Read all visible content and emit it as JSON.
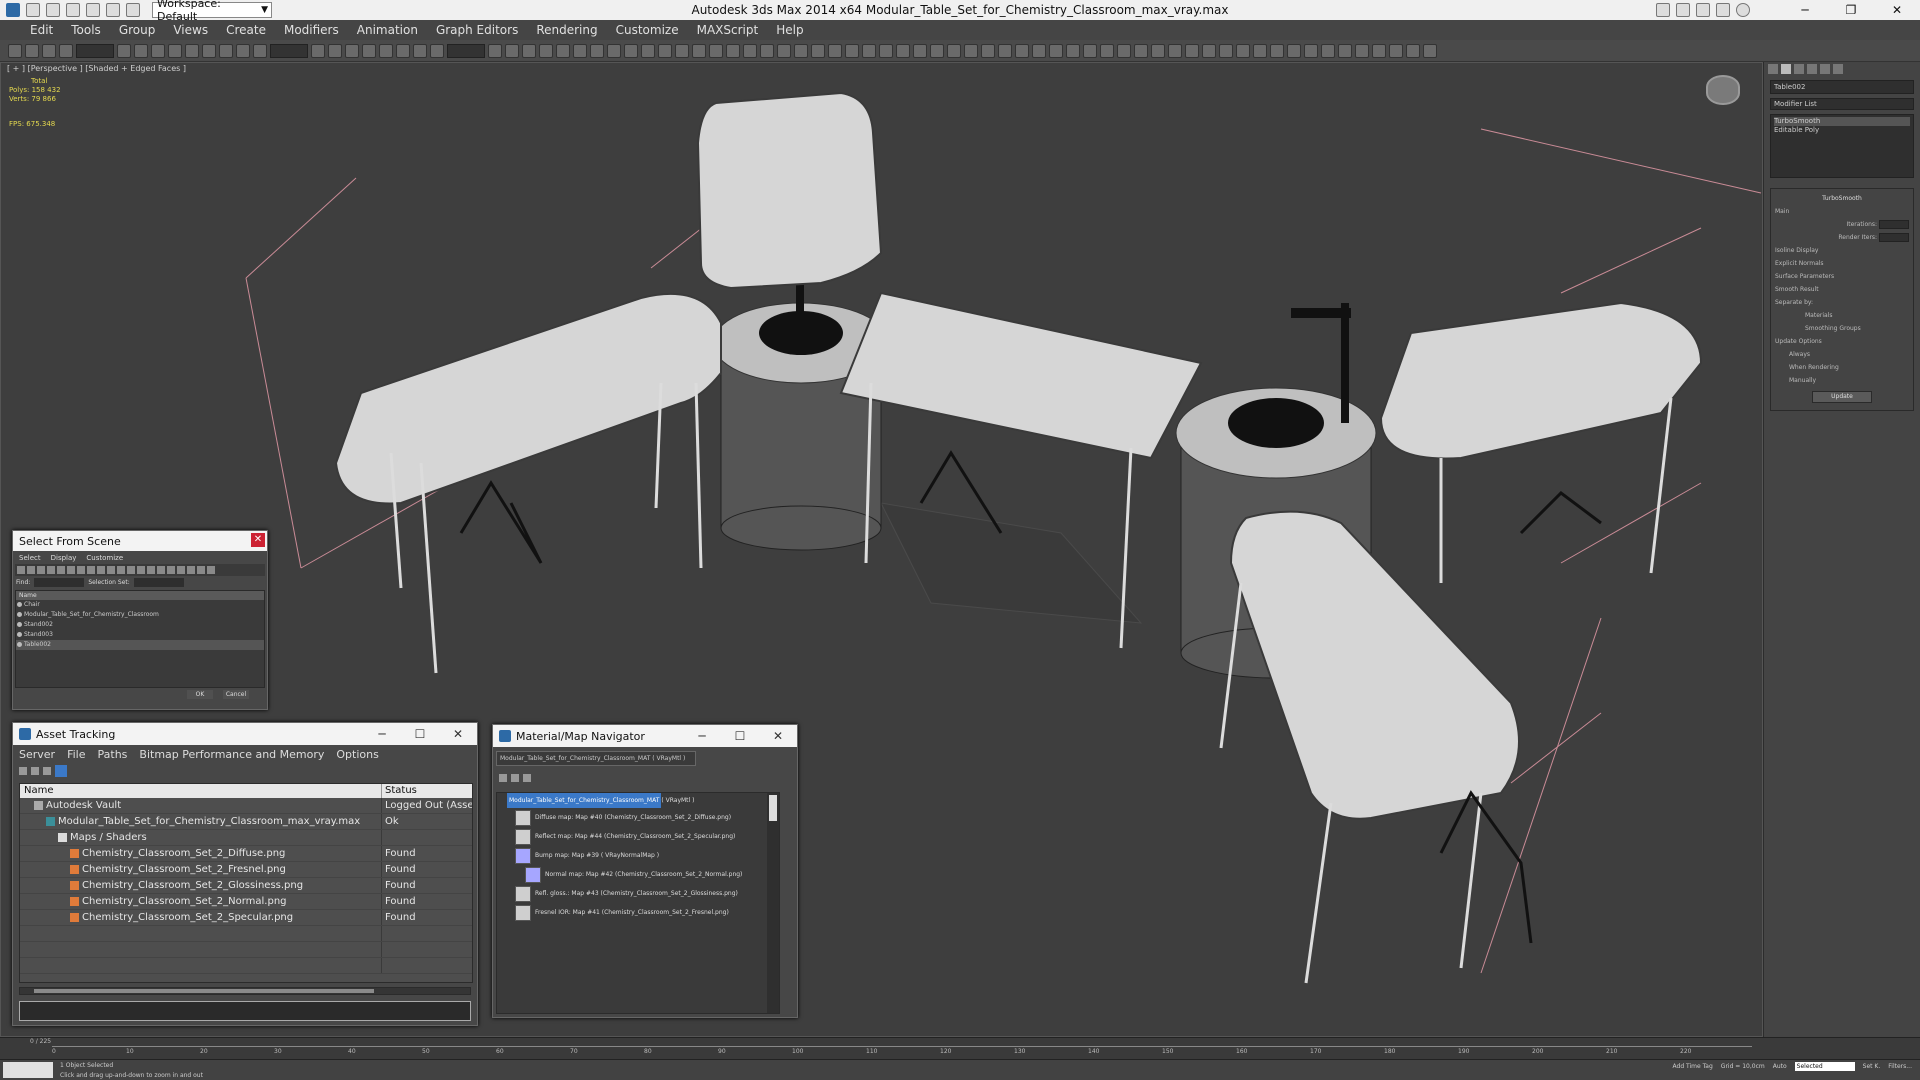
{
  "app": {
    "title": "Autodesk 3ds Max  2014 x64     Modular_Table_Set_for_Chemistry_Classroom_max_vray.max",
    "workspace": "Workspace: Default",
    "accent": "#3b79c8"
  },
  "menu": [
    "Edit",
    "Tools",
    "Group",
    "Views",
    "Create",
    "Modifiers",
    "Animation",
    "Graph Editors",
    "Rendering",
    "Customize",
    "MAXScript",
    "Help"
  ],
  "viewport": {
    "label": "[ + ] [Perspective ] [Shaded + Edged Faces ]",
    "stats": {
      "total_label": "Total",
      "polys_label": "Polys:",
      "polys": "158 432",
      "verts_label": "Verts:",
      "verts": "79 866",
      "fps_label": "FPS:",
      "fps": "675.348"
    }
  },
  "command_panel": {
    "object_name": "Table002",
    "modifier_list": "Modifier List",
    "stack": [
      "TurboSmooth",
      "Editable Poly"
    ],
    "rollout_title": "TurboSmooth",
    "main": "Main",
    "iterations_label": "Iterations:",
    "render_iters_label": "Render Iters:",
    "isoline": "Isoline Display",
    "explicit_normals": "Explicit Normals",
    "surface_params": "Surface Parameters",
    "smooth_result": "Smooth Result",
    "separate_by": "Separate by:",
    "materials": "Materials",
    "smoothing_groups": "Smoothing Groups",
    "update_options": "Update Options",
    "always": "Always",
    "when_rendering": "When Rendering",
    "manually": "Manually",
    "update_btn": "Update"
  },
  "select_from_scene": {
    "title": "Select From Scene",
    "menu": [
      "Select",
      "Display",
      "Customize"
    ],
    "find_label": "Find:",
    "selection_set": "Selection Set:",
    "column": "Name",
    "rows": [
      "Chair",
      "Modular_Table_Set_for_Chemistry_Classroom",
      "Stand002",
      "Stand003",
      "Table002"
    ],
    "ok": "OK",
    "cancel": "Cancel"
  },
  "asset_tracking": {
    "title": "Asset Tracking",
    "menu": [
      "Server",
      "File",
      "Paths",
      "Bitmap Performance and Memory",
      "Options"
    ],
    "col_name": "Name",
    "col_status": "Status",
    "rows": [
      {
        "name": "Autodesk Vault",
        "status": "Logged Out (Asset Tra",
        "icon": "vault"
      },
      {
        "name": "Modular_Table_Set_for_Chemistry_Classroom_max_vray.max",
        "status": "Ok",
        "icon": "max"
      },
      {
        "name": "Maps / Shaders",
        "status": "",
        "icon": "folder"
      },
      {
        "name": "Chemistry_Classroom_Set_2_Diffuse.png",
        "status": "Found",
        "icon": "png"
      },
      {
        "name": "Chemistry_Classroom_Set_2_Fresnel.png",
        "status": "Found",
        "icon": "png"
      },
      {
        "name": "Chemistry_Classroom_Set_2_Glossiness.png",
        "status": "Found",
        "icon": "png"
      },
      {
        "name": "Chemistry_Classroom_Set_2_Normal.png",
        "status": "Found",
        "icon": "png"
      },
      {
        "name": "Chemistry_Classroom_Set_2_Specular.png",
        "status": "Found",
        "icon": "png"
      }
    ]
  },
  "material_navigator": {
    "title": "Material/Map Navigator",
    "field": "Modular_Table_Set_for_Chemistry_Classroom_MAT  ( VRayMtl )",
    "root_name": "Modular_Table_Set_for_Chemistry_Classroom_MAT",
    "root_type": " ( VRayMtl )",
    "items": [
      "Diffuse map: Map #40 (Chemistry_Classroom_Set_2_Diffuse.png)",
      "Reflect map: Map #44 (Chemistry_Classroom_Set_2_Specular.png)",
      "Bump map: Map #39  ( VRayNormalMap )",
      "Normal map: Map #42 (Chemistry_Classroom_Set_2_Normal.png)",
      "Refl. gloss.: Map #43 (Chemistry_Classroom_Set_2_Glossiness.png)",
      "Fresnel IOR: Map #41 (Chemistry_Classroom_Set_2_Fresnel.png)"
    ]
  },
  "timeline": {
    "frame": "0 / 225",
    "ticks": [
      "0",
      "10",
      "20",
      "30",
      "40",
      "50",
      "60",
      "70",
      "80",
      "90",
      "100",
      "110",
      "120",
      "130",
      "140",
      "150",
      "160",
      "170",
      "180",
      "190",
      "200",
      "210",
      "220"
    ]
  },
  "status": {
    "selection": "1 Object Selected",
    "prompt": "Click and drag up-and-down to zoom in and out",
    "grid": "Grid = 10,0cm",
    "auto": "Auto",
    "selected": "Selected",
    "set_key": "Set K.",
    "filters": "Filters...",
    "add_time_tag": "Add Time Tag"
  }
}
